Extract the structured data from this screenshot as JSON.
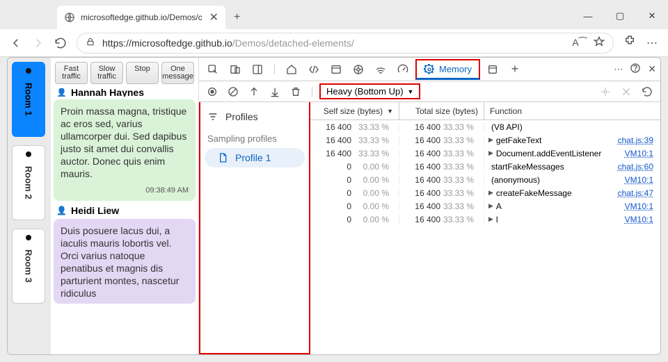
{
  "browser": {
    "tab_title": "microsoftedge.github.io/Demos/c",
    "plus": "+",
    "win_min": "—",
    "win_max": "▢",
    "win_close": "✕",
    "url_host": "https://microsoftedge.github.io",
    "url_path": "/Demos/detached-elements/",
    "aa": "A⁀",
    "dots": "⋯"
  },
  "rooms": [
    {
      "label": "Room 1",
      "active": true
    },
    {
      "label": "Room 2",
      "active": false
    },
    {
      "label": "Room 3",
      "active": false
    }
  ],
  "chat": {
    "buttons": [
      {
        "l1": "Fast",
        "l2": "traffic"
      },
      {
        "l1": "Slow",
        "l2": "traffic"
      },
      {
        "l1": "Stop",
        "l2": ""
      },
      {
        "l1": "One",
        "l2": "message"
      }
    ],
    "sender0": "Hannah Haynes",
    "msg1": "Proin massa magna, tristique ac eros sed, varius ullamcorper dui. Sed dapibus justo sit amet dui convallis auctor. Donec quis enim mauris.",
    "ts1": "09:38:49 AM",
    "sender2": "Heidi Liew",
    "msg2": "Duis posuere lacus dui, a iaculis mauris lobortis vel. Orci varius natoque penatibus et magnis dis parturient montes, nascetur ridiculus"
  },
  "devtools": {
    "memory_label": "Memory",
    "view_selector": "Heavy (Bottom Up)",
    "profiles_hdr": "Profiles",
    "sampling_hdr": "Sampling profiles",
    "profile1": "Profile 1",
    "col_self": "Self size (bytes)",
    "col_total": "Total size (bytes)",
    "col_func": "Function",
    "rows": [
      {
        "self": "16 400",
        "selfp": "33.33 %",
        "total": "16 400",
        "totalp": "33.33 %",
        "fn": "(V8 API)",
        "tri": "",
        "link": ""
      },
      {
        "self": "16 400",
        "selfp": "33.33 %",
        "total": "16 400",
        "totalp": "33.33 %",
        "fn": "getFakeText",
        "tri": "▶",
        "link": "chat.js:39"
      },
      {
        "self": "16 400",
        "selfp": "33.33 %",
        "total": "16 400",
        "totalp": "33.33 %",
        "fn": "Document.addEventListener",
        "tri": "▶",
        "link": "VM10:1"
      },
      {
        "self": "0",
        "selfp": "0.00 %",
        "total": "16 400",
        "totalp": "33.33 %",
        "fn": "startFakeMessages",
        "tri": "",
        "link": "chat.js:60"
      },
      {
        "self": "0",
        "selfp": "0.00 %",
        "total": "16 400",
        "totalp": "33.33 %",
        "fn": "(anonymous)",
        "tri": "",
        "link": "VM10:1"
      },
      {
        "self": "0",
        "selfp": "0.00 %",
        "total": "16 400",
        "totalp": "33.33 %",
        "fn": "createFakeMessage",
        "tri": "▶",
        "link": "chat.js:47"
      },
      {
        "self": "0",
        "selfp": "0.00 %",
        "total": "16 400",
        "totalp": "33.33 %",
        "fn": "A",
        "tri": "▶",
        "link": "VM10:1"
      },
      {
        "self": "0",
        "selfp": "0.00 %",
        "total": "16 400",
        "totalp": "33.33 %",
        "fn": "l",
        "tri": "▶",
        "link": "VM10:1"
      }
    ]
  }
}
